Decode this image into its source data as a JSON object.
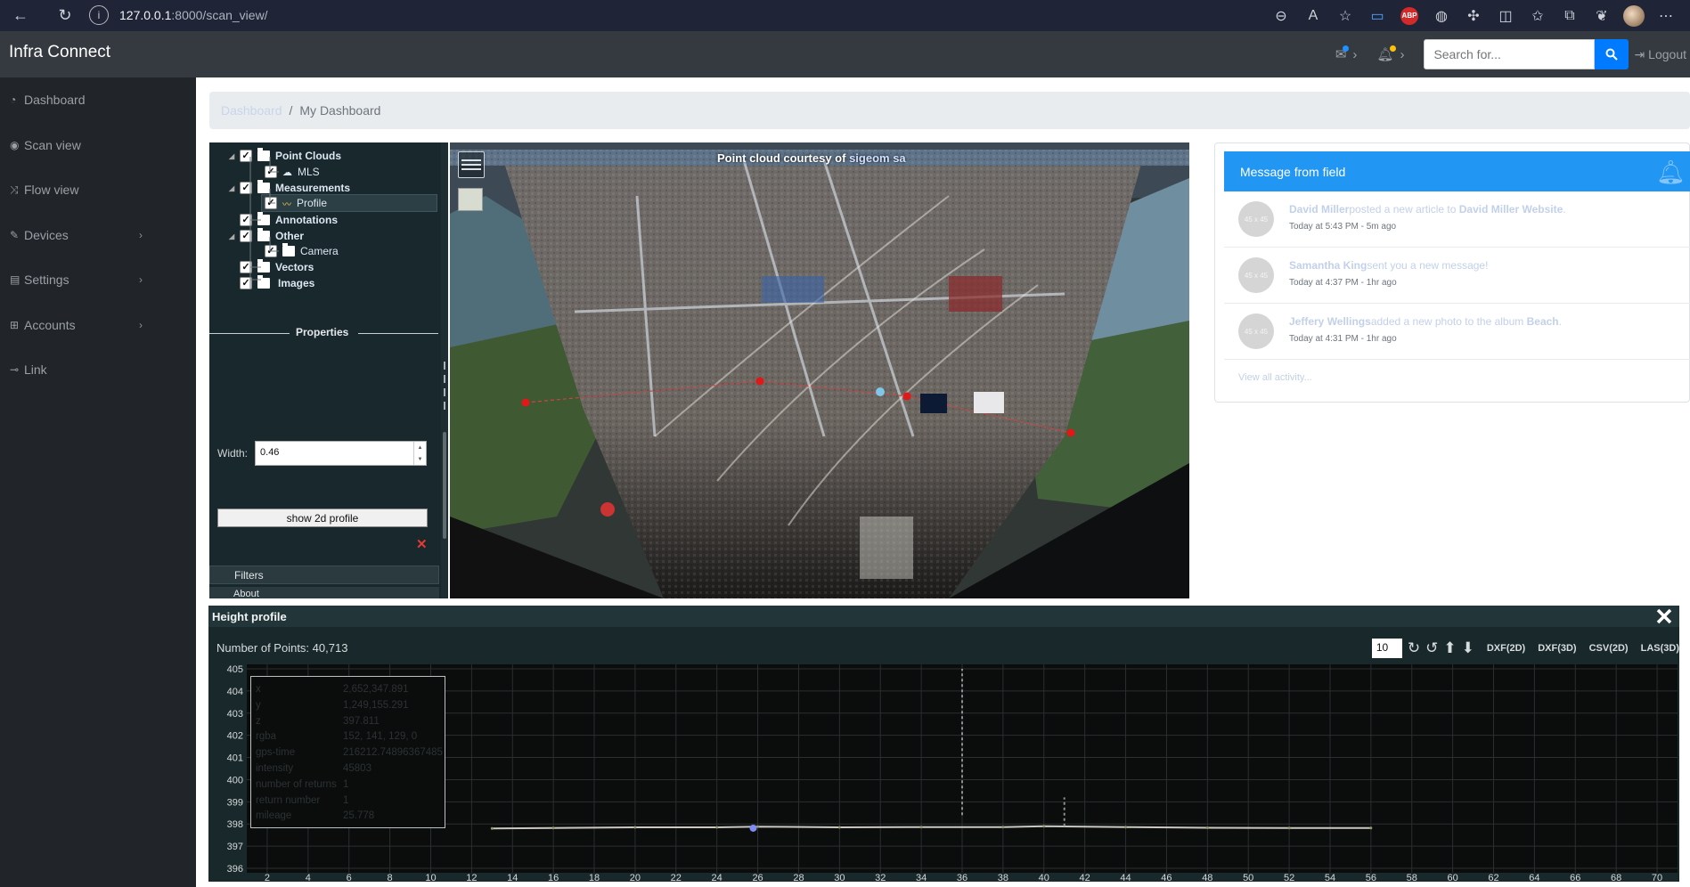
{
  "browser": {
    "url": "127.0.0.1:8000/scan_view/",
    "url_host": "127.0.0.1",
    "url_rest": ":8000/scan_view/",
    "abp_label": "ABP"
  },
  "navbar": {
    "brand": "Infra Connect",
    "search_placeholder": "Search for...",
    "logout_label": "Logout",
    "mail_dot_color": "#1e90ff",
    "bell_dot_color": "#ffc107"
  },
  "sidebar": {
    "items": [
      {
        "label": "Dashboard",
        "icon": "dashboard-icon",
        "glyph": "◔",
        "has_arrow": false
      },
      {
        "label": "Scan view",
        "icon": "globe-icon",
        "glyph": "◉",
        "has_arrow": false
      },
      {
        "label": "Flow view",
        "icon": "shuffle-icon",
        "glyph": "⤨",
        "has_arrow": false
      },
      {
        "label": "Devices",
        "icon": "wrench-icon",
        "glyph": "✎",
        "has_arrow": true
      },
      {
        "label": "Settings",
        "icon": "file-icon",
        "glyph": "▤",
        "has_arrow": true
      },
      {
        "label": "Accounts",
        "icon": "sitemap-icon",
        "glyph": "⊞",
        "has_arrow": true
      },
      {
        "label": "Link",
        "icon": "link-icon",
        "glyph": "⊸",
        "has_arrow": false
      }
    ]
  },
  "breadcrumb": {
    "items": [
      "Dashboard",
      "My Dashboard"
    ],
    "separator": "/"
  },
  "scene_tree": {
    "point_clouds": "Point Clouds",
    "mls": "MLS",
    "measurements": "Measurements",
    "profile": "Profile",
    "annotations": "Annotations",
    "other": "Other",
    "camera": "Camera",
    "vectors": "Vectors",
    "images": "Images"
  },
  "properties": {
    "title": "Properties",
    "width_label": "Width:",
    "width_value": "0.46",
    "show_profile_label": "show 2d profile",
    "remove_glyph": "✕"
  },
  "accordion": {
    "filters": "Filters",
    "about": "About"
  },
  "viewport": {
    "credit_prefix": "Point cloud courtesy of ",
    "credit_link": "sigeom sa"
  },
  "messages": {
    "title": "Message from field",
    "placeholder_label": "45 x 45",
    "items": [
      {
        "name": "David Miller",
        "action": "posted a new article to ",
        "target": "David Miller Website",
        "end": ".",
        "time": "Today at 5:43 PM - 5m ago"
      },
      {
        "name": "Samantha King",
        "action": "sent you a new message!",
        "target": "",
        "end": "",
        "time": "Today at 4:37 PM - 1hr ago"
      },
      {
        "name": "Jeffery Wellings",
        "action": "added a new photo to the album ",
        "target": "Beach",
        "end": ".",
        "time": "Today at 4:31 PM - 1hr ago"
      }
    ],
    "view_all": "View all activity..."
  },
  "height_profile": {
    "title": "Height profile",
    "points_label": "Number of Points:",
    "points_value": "40,713",
    "point_budget": "10",
    "exports": [
      "DXF(2D)",
      "DXF(3D)",
      "CSV(2D)",
      "LAS(3D)"
    ],
    "info": [
      {
        "key": "x",
        "value": "2,652,347.891"
      },
      {
        "key": "y",
        "value": "1,249,155.291"
      },
      {
        "key": "z",
        "value": "397.811"
      },
      {
        "key": "rgba",
        "value": "152, 141, 129, 0"
      },
      {
        "key": "gps-time",
        "value": "216212.74896367485"
      },
      {
        "key": "intensity",
        "value": "45803"
      },
      {
        "key": "number of returns",
        "value": "1"
      },
      {
        "key": "return number",
        "value": "1"
      },
      {
        "key": "mileage",
        "value": "25.778"
      }
    ]
  },
  "chart_data": {
    "type": "scatter",
    "x_ticks": [
      2,
      4,
      6,
      8,
      10,
      12,
      14,
      16,
      18,
      20,
      22,
      24,
      26,
      28,
      30,
      32,
      34,
      36,
      38,
      40,
      42,
      44,
      46,
      48,
      50,
      52,
      54,
      56,
      58,
      60,
      62,
      64,
      66,
      68,
      70
    ],
    "y_ticks": [
      405,
      404,
      403,
      402,
      401,
      400,
      399,
      398,
      397,
      396
    ],
    "xlim": [
      1.0,
      71.0
    ],
    "ylim": [
      395.8,
      405.2
    ],
    "grid": true,
    "series": [
      {
        "color": "#c9c9c1",
        "points": [
          [
            13,
            397.8
          ],
          [
            16,
            397.82
          ],
          [
            20,
            397.85
          ],
          [
            24,
            397.85
          ],
          [
            26,
            397.88
          ],
          [
            30,
            397.85
          ],
          [
            34,
            397.86
          ],
          [
            38,
            397.86
          ],
          [
            40,
            397.9
          ],
          [
            44,
            397.86
          ],
          [
            48,
            397.83
          ],
          [
            52,
            397.82
          ],
          [
            56,
            397.82
          ]
        ]
      }
    ],
    "selected_point": [
      25.778,
      397.811
    ],
    "objects": [
      {
        "x": 41,
        "y_low": 397.9,
        "y_high": 399.2
      },
      {
        "x": 36,
        "y_low": 398.4,
        "y_high": 405.0
      }
    ]
  }
}
